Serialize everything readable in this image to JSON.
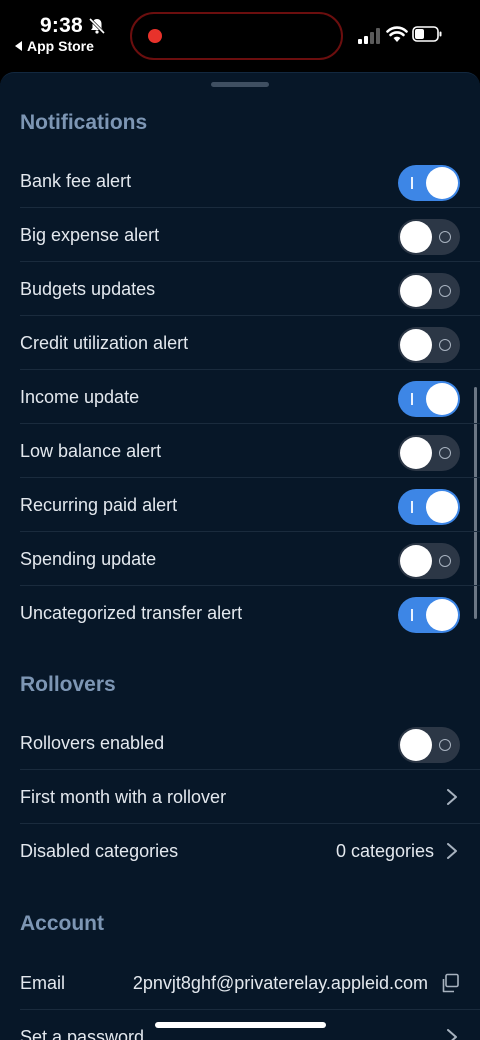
{
  "status_bar": {
    "time": "9:38",
    "back_app": "App Store",
    "recording_color": "#e8322b"
  },
  "notifications": {
    "title": "Notifications",
    "items": [
      {
        "label": "Bank fee alert",
        "enabled": true
      },
      {
        "label": "Big expense alert",
        "enabled": false
      },
      {
        "label": "Budgets updates",
        "enabled": false
      },
      {
        "label": "Credit utilization alert",
        "enabled": false
      },
      {
        "label": "Income update",
        "enabled": true
      },
      {
        "label": "Low balance alert",
        "enabled": false
      },
      {
        "label": "Recurring paid alert",
        "enabled": true
      },
      {
        "label": "Spending update",
        "enabled": false
      },
      {
        "label": "Uncategorized transfer alert",
        "enabled": true
      }
    ]
  },
  "rollovers": {
    "title": "Rollovers",
    "enabled_label": "Rollovers enabled",
    "enabled": false,
    "first_month_label": "First month with a rollover",
    "disabled_categories_label": "Disabled categories",
    "disabled_categories_value": "0 categories"
  },
  "account": {
    "title": "Account",
    "email_label": "Email",
    "email_value": "2pnvjt8ghf@privaterelay.appleid.com",
    "password_label": "Set a password"
  },
  "colors": {
    "sheet_bg": "#071728",
    "toggle_on": "#3d86e6",
    "toggle_off": "#2c3746",
    "section_title": "#7d96b4"
  }
}
